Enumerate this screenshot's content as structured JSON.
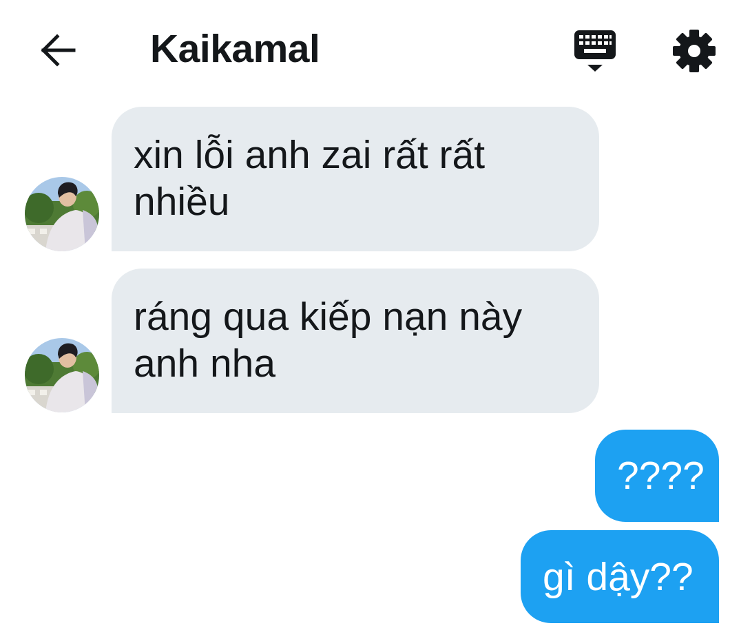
{
  "header": {
    "title": "Kaikamal",
    "back_icon": "arrow-left-icon",
    "keyboard_icon": "keyboard-icon",
    "settings_icon": "gear-icon"
  },
  "colors": {
    "incoming_bubble": "#e6ebef",
    "outgoing_bubble": "#1da1f2",
    "text": "#14171a"
  },
  "messages": [
    {
      "direction": "incoming",
      "line1": "xin lỗi anh zai rất rất",
      "line2": "nhiều"
    },
    {
      "direction": "incoming",
      "line1": "ráng qua kiếp nạn này",
      "line2": "anh nha"
    },
    {
      "direction": "outgoing",
      "text": "????"
    },
    {
      "direction": "outgoing",
      "text": "gì dậy??"
    }
  ]
}
